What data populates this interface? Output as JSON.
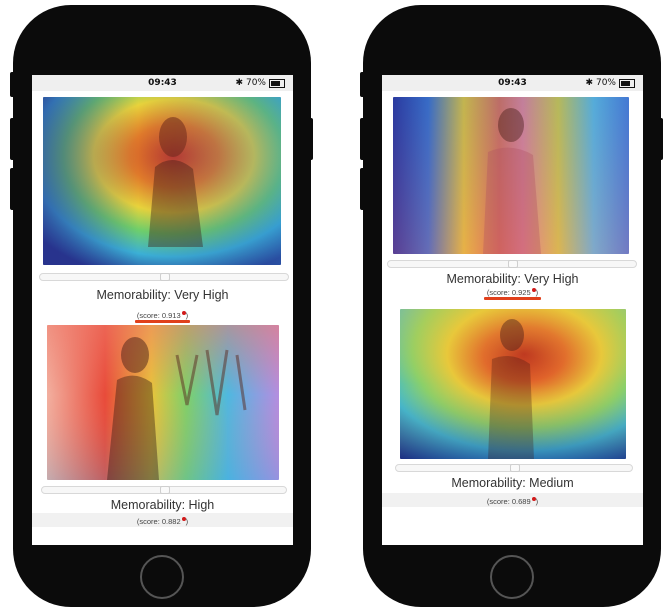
{
  "colors": {
    "phone_body": "#0b0b0b",
    "screen_bg": "#ffffff",
    "accent_underline": "#e0401c",
    "score_dot": "#d21a1a"
  },
  "phones": [
    {
      "status": {
        "time": "09:43",
        "bluetooth_icon": "bluetooth-icon",
        "battery_pct": "70%"
      },
      "cards": [
        {
          "memorability": "Memorability: Very High",
          "score": "(score: 0.913",
          "slider_position": 0.5,
          "highlighted": true
        },
        {
          "memorability": "Memorability: High",
          "score": "(score: 0.882",
          "slider_position": 0.5,
          "highlighted": false
        }
      ]
    },
    {
      "status": {
        "time": "09:43",
        "bluetooth_icon": "bluetooth-icon",
        "battery_pct": "70%"
      },
      "cards": [
        {
          "memorability": "Memorability: Very High",
          "score": "(score: 0.925",
          "slider_position": 0.5,
          "highlighted": true
        },
        {
          "memorability": "Memorability: Medium",
          "score": "(score: 0.689",
          "slider_position": 0.5,
          "highlighted": false
        }
      ]
    }
  ]
}
